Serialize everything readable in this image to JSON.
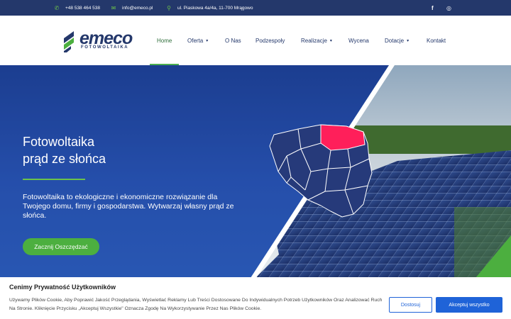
{
  "topbar": {
    "phone": "+48 538 464 538",
    "email": "info@emeco.pl",
    "address": "ul. Piaskowa 4a/4a, 11-700 Mrągowo",
    "social": [
      "f",
      "◎"
    ]
  },
  "logo": {
    "word": "emeco",
    "sub": "FOTOWOLTAIKA"
  },
  "nav": [
    {
      "label": "Home",
      "active": true
    },
    {
      "label": "Oferta",
      "dropdown": true
    },
    {
      "label": "O Nas"
    },
    {
      "label": "Podzespoły"
    },
    {
      "label": "Realizacje",
      "dropdown": true
    },
    {
      "label": "Wycena"
    },
    {
      "label": "Dotacje",
      "dropdown": true
    },
    {
      "label": "Kontakt"
    }
  ],
  "hero": {
    "title_line1": "Fotowoltaika",
    "title_line2": "prąd ze słońca",
    "description": "Fotowoltaika to ekologiczne i ekonomiczne rozwiązanie dla Twojego domu, firmy i gospodarstwa. Wytwarzaj własny prąd ze słońca.",
    "cta": "Zacznij Oszczędzać"
  },
  "cookie": {
    "title": "Cenimy Prywatność Użytkowników",
    "text": "Używamy Plików Cookie, Aby Poprawić Jakość Przeglądania, Wyświetlać Reklamy Lub Treści Dostosowane Do Indywidualnych Potrzeb Użytkowników Oraz Analizować Ruch Na Stronie. Kliknięcie Przycisku „Akceptuj Wszystkie\" Oznacza Zgodę Na Wykorzystywanie Przez Nas Plików Cookie.",
    "customize_label": "Dostosuj",
    "accept_label": "Akceptuj wszystko"
  },
  "colors": {
    "topbar_bg": "#24386b",
    "accent_green": "#4caf3f",
    "nav_text": "#24386b",
    "map_highlight": "#ff1f5a",
    "button_blue": "#1f63d8"
  }
}
